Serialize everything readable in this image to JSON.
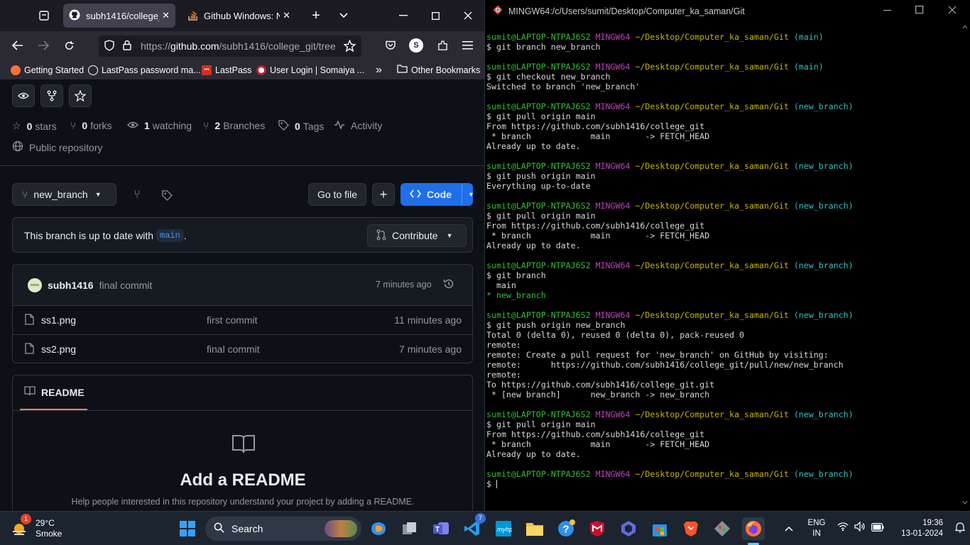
{
  "browser": {
    "tabs": [
      {
        "label": "subh1416/college_git",
        "active": true
      },
      {
        "label": "Github Windows: Ne",
        "active": false
      }
    ],
    "url_prefix": "https://",
    "url_domain": "github.com",
    "url_path": "/subh1416/college_git/tree",
    "profile_letter": "S",
    "bookmarks": [
      {
        "label": "Getting Started",
        "icon": "firefox-icon",
        "color": "#ff7139"
      },
      {
        "label": "LastPass password ma...",
        "icon": "globe-icon",
        "color": "#fbfbfe"
      },
      {
        "label": "LastPass",
        "icon": "lastpass-icon",
        "color": "#d32d27"
      },
      {
        "label": "User Login | Somaiya ...",
        "icon": "somaiya-icon",
        "color": "#b7202e"
      }
    ],
    "other_bookmarks": "Other Bookmarks",
    "overflow_icon": "»"
  },
  "repo": {
    "stats": {
      "stars_count": "0",
      "stars_label": "stars",
      "forks_count": "0",
      "forks_label": "forks",
      "watching_count": "1",
      "watching_label": "watching",
      "branches_count": "2",
      "branches_label": "Branches",
      "tags_count": "0",
      "tags_label": "Tags",
      "activity_label": "Activity"
    },
    "visibility": "Public repository",
    "branch_selector": "new_branch",
    "goto_file": "Go to file",
    "add_symbol": "+",
    "code_button": "Code",
    "branch_status_prefix": "This branch is up to date with",
    "branch_status_branch": "main",
    "branch_status_suffix": ".",
    "contribute": "Contribute",
    "latest_commit": {
      "author": "subh1416",
      "message": "final commit",
      "time": "7 minutes ago"
    },
    "files": [
      {
        "name": "ss1.png",
        "message": "first commit",
        "time": "11 minutes ago"
      },
      {
        "name": "ss2.png",
        "message": "final commit",
        "time": "7 minutes ago"
      }
    ],
    "readme_tab": "README",
    "readme_title": "Add a README",
    "readme_help": "Help people interested in this repository understand your project by adding a README."
  },
  "terminal": {
    "title": "MINGW64:/c/Users/sumit/Desktop/Computer_ka_saman/Git",
    "user": "sumit@LAPTOP-NTPAJ6S2",
    "env": "MINGW64",
    "path": "~/Desktop/Computer_ka_saman/Git",
    "blocks": [
      {
        "branch": "(main)",
        "cmd": "$ git branch new_branch",
        "out": []
      },
      {
        "branch": "(main)",
        "cmd": "$ git checkout new_branch",
        "out": [
          "Switched to branch 'new_branch'"
        ]
      },
      {
        "branch": "(new_branch)",
        "cmd": "$ git pull origin main",
        "out": [
          "From https://github.com/subh1416/college_git",
          " * branch            main       -> FETCH_HEAD",
          "Already up to date."
        ]
      },
      {
        "branch": "(new_branch)",
        "cmd": "$ git push origin main",
        "out": [
          "Everything up-to-date"
        ]
      },
      {
        "branch": "(new_branch)",
        "cmd": "$ git pull origin main",
        "out": [
          "From https://github.com/subh1416/college_git",
          " * branch            main       -> FETCH_HEAD",
          "Already up to date."
        ]
      },
      {
        "branch": "(new_branch)",
        "cmd": "$ git branch",
        "out": [
          "  main"
        ],
        "green_out": [
          "* new_branch"
        ]
      },
      {
        "branch": "(new_branch)",
        "cmd": "$ git push origin new_branch",
        "out": [
          "Total 0 (delta 0), reused 0 (delta 0), pack-reused 0",
          "remote:",
          "remote: Create a pull request for 'new_branch' on GitHub by visiting:",
          "remote:      https://github.com/subh1416/college_git/pull/new/new_branch",
          "remote:",
          "To https://github.com/subh1416/college_git.git",
          " * [new branch]      new_branch -> new_branch"
        ]
      },
      {
        "branch": "(new_branch)",
        "cmd": "$ git pull origin main",
        "out": [
          "From https://github.com/subh1416/college_git",
          " * branch            main       -> FETCH_HEAD",
          "Already up to date."
        ]
      },
      {
        "branch": "(new_branch)",
        "cmd": "$ ",
        "out": [],
        "cursor": true
      }
    ]
  },
  "taskbar": {
    "weather_temp": "29°C",
    "weather_desc": "Smoke",
    "weather_badge": "1",
    "search_label": "Search",
    "lang_1": "ENG",
    "lang_2": "IN",
    "time": "19:36",
    "date": "13-01-2024",
    "vscode_badge": "7"
  },
  "colors": {
    "code_button": "#238636",
    "code_button_blue": "#1f6feb",
    "readme_underline": "#f78166"
  }
}
